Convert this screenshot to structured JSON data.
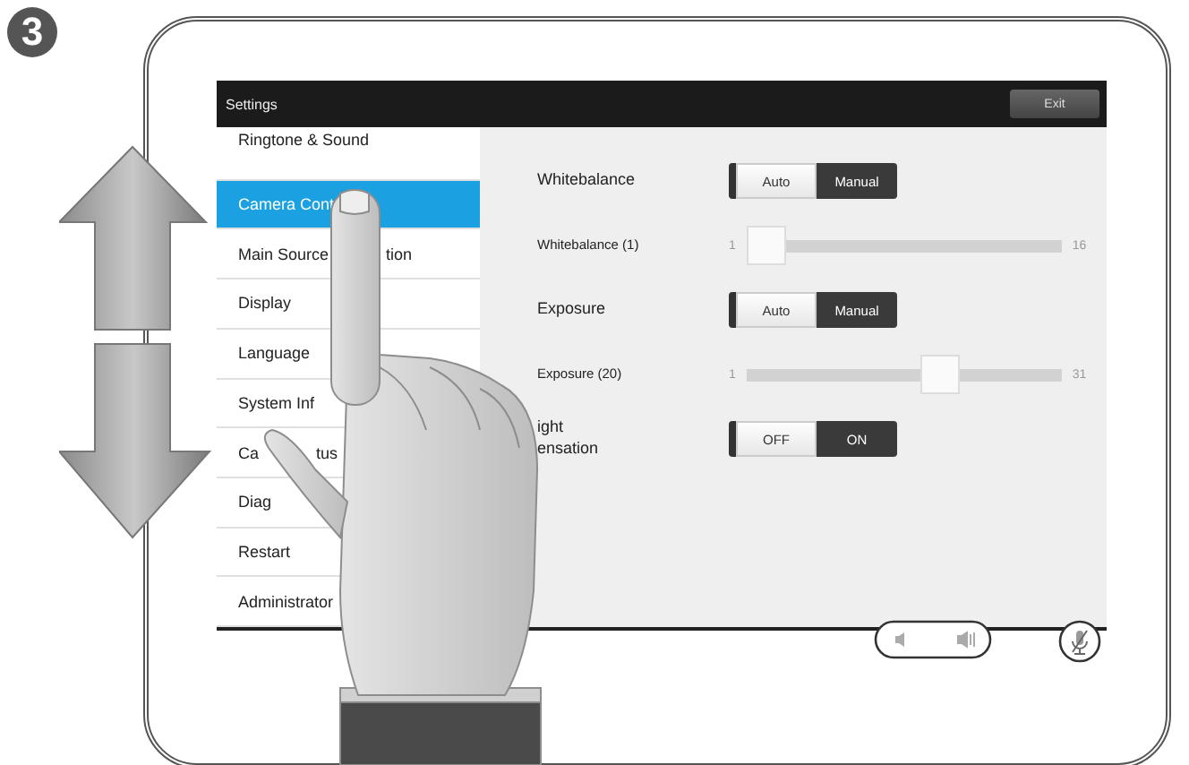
{
  "step_badge": "3",
  "screen": {
    "title": "Settings",
    "exit_button": "Exit",
    "menu": [
      {
        "label": "Ringtone & Sound",
        "selected": false
      },
      {
        "label": "Camera Cont",
        "selected": true
      },
      {
        "label": "Main Source",
        "tail": "tion",
        "selected": false
      },
      {
        "label": "Display",
        "selected": false
      },
      {
        "label": "Language",
        "selected": false
      },
      {
        "label": "System Inf",
        "selected": false
      },
      {
        "label": "Ca",
        "tail": "tus",
        "selected": false
      },
      {
        "label": "Diag",
        "selected": false
      },
      {
        "label": "Restart",
        "selected": false
      },
      {
        "label": "Administrator",
        "selected": false
      }
    ],
    "settings": [
      {
        "kind": "toggle",
        "label": "Whitebalance",
        "options": [
          {
            "label": "Auto",
            "selected": false
          },
          {
            "label": "Manual",
            "selected": true
          }
        ]
      },
      {
        "kind": "slider",
        "label": "Whitebalance (1)",
        "min": "1",
        "max": "16",
        "level": 0
      },
      {
        "kind": "toggle",
        "label": "Exposure",
        "options": [
          {
            "label": "Auto",
            "selected": false
          },
          {
            "label": "Manual",
            "selected": true
          }
        ]
      },
      {
        "kind": "slider",
        "label": "Exposure (20)",
        "min": "1",
        "max": "31",
        "level": 0.63
      },
      {
        "kind": "toggle",
        "label": "ight\nensation",
        "options": [
          {
            "label": "OFF",
            "selected": false
          },
          {
            "label": "ON",
            "selected": true
          }
        ]
      }
    ]
  }
}
